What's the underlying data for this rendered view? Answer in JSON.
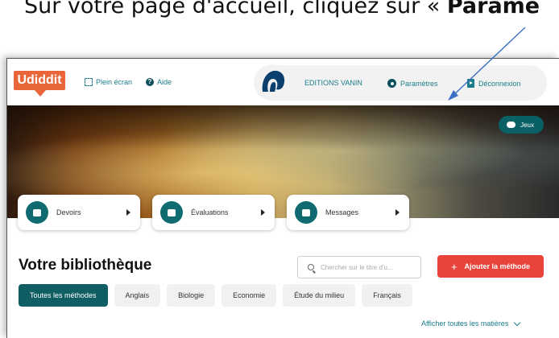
{
  "caption": {
    "text": "Sur votre page d'accueil, cliquez sur « ",
    "bold": "Paramè"
  },
  "topbar": {
    "logo": "Udiddit",
    "fullscreen": "Plein écran",
    "help": "Aide",
    "publisher": "EDITIONS VANIN",
    "settings": "Paramètres",
    "logout": "Déconnexion"
  },
  "banner": {
    "games": "Jeux"
  },
  "cards": [
    {
      "label": "Devoirs",
      "icon": "homework-icon"
    },
    {
      "label": "Évaluations",
      "icon": "evaluations-icon"
    },
    {
      "label": "Messages",
      "icon": "messages-icon"
    }
  ],
  "library": {
    "title": "Votre bibliothèque",
    "search_placeholder": "Chercher sur le titre d'u...",
    "add_label": "Ajouter la méthode",
    "chips": [
      "Toutes les méthodes",
      "Anglais",
      "Biologie",
      "Economie",
      "Étude du milieu",
      "Français"
    ],
    "show_all": "Afficher toutes les matières"
  },
  "colors": {
    "teal": "#0f5e63",
    "accent": "#e8443c",
    "logo": "#e9663a",
    "arrow": "#3b6fc4"
  }
}
